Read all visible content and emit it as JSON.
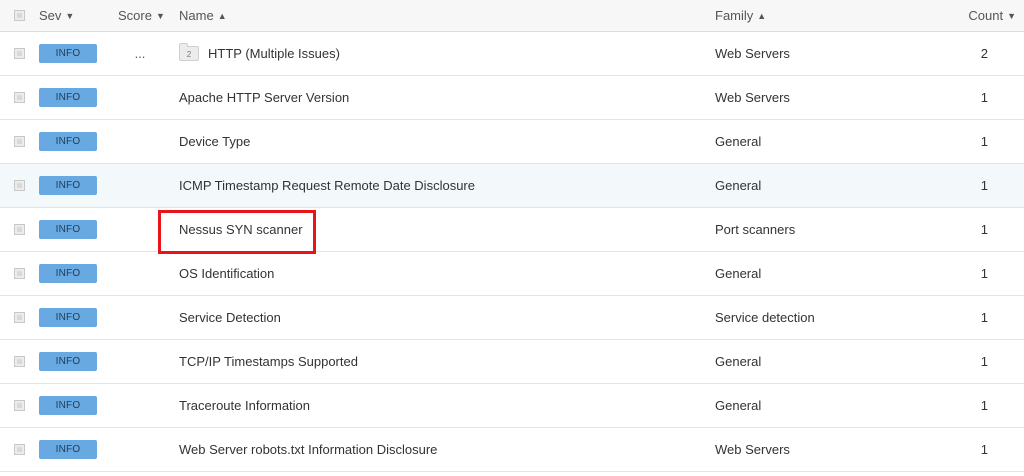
{
  "header": {
    "sev": "Sev",
    "score": "Score",
    "name": "Name",
    "family": "Family",
    "count": "Count",
    "caret_down": "▼",
    "caret_up": "▲"
  },
  "rows": [
    {
      "severity": "INFO",
      "score": "...",
      "folder_count": "2",
      "name": "HTTP (Multiple Issues)",
      "family": "Web Servers",
      "count": "2"
    },
    {
      "severity": "INFO",
      "score": "",
      "name": "Apache HTTP Server Version",
      "family": "Web Servers",
      "count": "1"
    },
    {
      "severity": "INFO",
      "score": "",
      "name": "Device Type",
      "family": "General",
      "count": "1"
    },
    {
      "severity": "INFO",
      "score": "",
      "name": "ICMP Timestamp Request Remote Date Disclosure",
      "family": "General",
      "count": "1"
    },
    {
      "severity": "INFO",
      "score": "",
      "name": "Nessus SYN scanner",
      "family": "Port scanners",
      "count": "1"
    },
    {
      "severity": "INFO",
      "score": "",
      "name": "OS Identification",
      "family": "General",
      "count": "1"
    },
    {
      "severity": "INFO",
      "score": "",
      "name": "Service Detection",
      "family": "Service detection",
      "count": "1"
    },
    {
      "severity": "INFO",
      "score": "",
      "name": "TCP/IP Timestamps Supported",
      "family": "General",
      "count": "1"
    },
    {
      "severity": "INFO",
      "score": "",
      "name": "Traceroute Information",
      "family": "General",
      "count": "1"
    },
    {
      "severity": "INFO",
      "score": "",
      "name": "Web Server robots.txt Information Disclosure",
      "family": "Web Servers",
      "count": "1"
    }
  ],
  "colors": {
    "badge_info": "#67a9e0",
    "highlight": "#e8141a",
    "row_hover": "#f3f8fb"
  }
}
